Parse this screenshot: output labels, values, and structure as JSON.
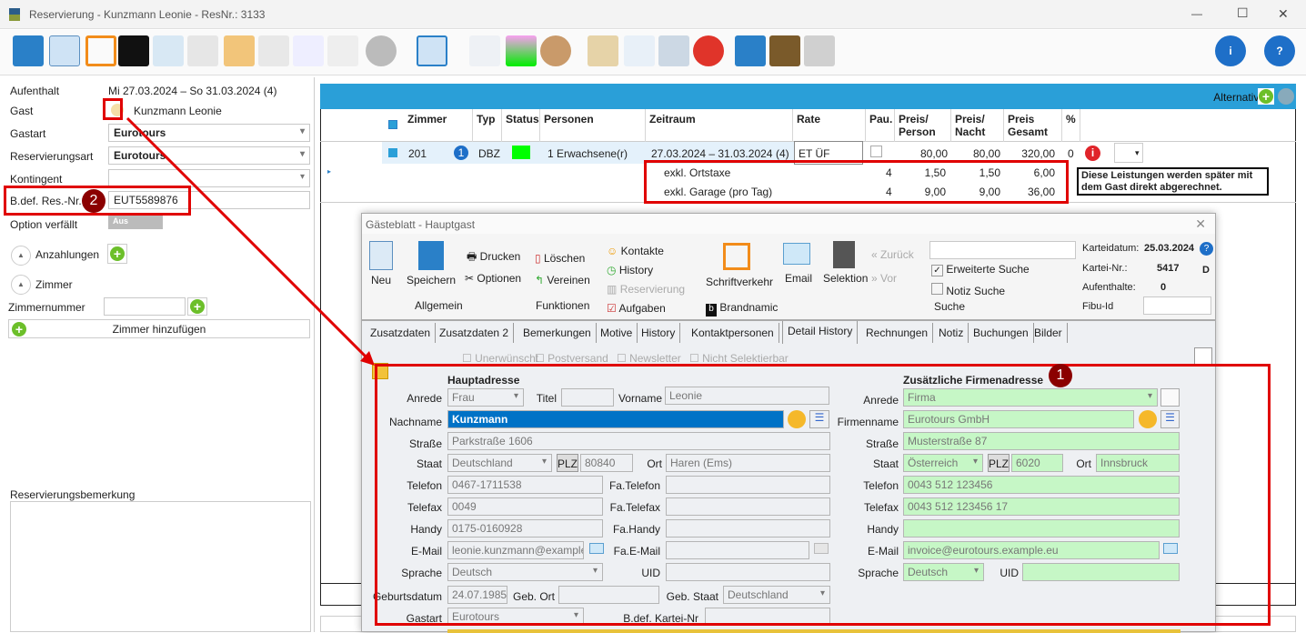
{
  "window": {
    "title": "Reservierung - Kunzmann Leonie - ResNr.: 3133",
    "minimize": "—",
    "maximize": "☐",
    "close": "✕"
  },
  "left": {
    "aufenthalt_label": "Aufenthalt",
    "aufenthalt_value": "Mi 27.03.2024 – So 31.03.2024 (4)",
    "gast_label": "Gast",
    "gast_value": "Kunzmann Leonie",
    "gastart_label": "Gastart",
    "gastart_value": "Eurotours",
    "resart_label": "Reservierungsart",
    "resart_value": "Eurotours",
    "kontingent_label": "Kontingent",
    "kontingent_value": "",
    "bdef_label": "B.def. Res.-Nr.",
    "bdef_value": "EUT5589876",
    "option_label": "Option verfällt",
    "option_toggle": "Aus",
    "anzahlungen": "Anzahlungen",
    "zimmer": "Zimmer",
    "zimmernummer": "Zimmernummer",
    "zimmer_add": "Zimmer hinzufügen",
    "bemerkung_label": "Reservierungsbemerkung"
  },
  "badges": {
    "one": "1",
    "two": "2"
  },
  "grid": {
    "alternative": "Alternative",
    "headers": [
      "Zimmer",
      "Typ",
      "Status",
      "Personen",
      "Zeitraum",
      "Rate",
      "Pau.",
      "Preis/ Person",
      "Preis/ Nacht",
      "Preis Gesamt",
      "%"
    ],
    "row": {
      "zimmer": "201",
      "num": "1",
      "typ": "DBZ",
      "status_color": "#00ff00",
      "personen": "1 Erwachsene(r)",
      "zeitraum": "27.03.2024 – 31.03.2024",
      "nights": "(4)",
      "rate": "ET ÜF",
      "preis_person": "80,00",
      "preis_nacht": "80,00",
      "preis_gesamt": "320,00",
      "prozent": "0"
    },
    "subrows": [
      {
        "name": "exkl. Ortstaxe",
        "pau": "4",
        "person": "1,50",
        "nacht": "1,50",
        "gesamt": "6,00"
      },
      {
        "name": "exkl. Garage (pro Tag)",
        "pau": "4",
        "person": "9,00",
        "nacht": "9,00",
        "gesamt": "36,00"
      }
    ],
    "note": "Diese Leistungen werden später mit dem Gast direkt abgerechnet."
  },
  "dialog": {
    "title": "Gästeblatt - Hauptgast",
    "ribbon": {
      "neu": "Neu",
      "speichern": "Speichern",
      "drucken": "Drucken",
      "optionen": "Optionen",
      "allgemein": "Allgemein",
      "loeschen": "Löschen",
      "vereinen": "Vereinen",
      "funktionen": "Funktionen",
      "kontakte": "Kontakte",
      "history": "History",
      "reservierung": "Reservierung",
      "aufgaben": "Aufgaben",
      "schriftverkehr": "Schriftverkehr",
      "email": "Email",
      "brandnamic": "Brandnamic",
      "selektion": "Selektion",
      "zurueck": "Zurück",
      "vor": "Vor",
      "suche_value": "",
      "erweiterte": "Erweiterte Suche",
      "notiz_suche": "Notiz Suche",
      "suche": "Suche",
      "karteidatum_label": "Karteidatum:",
      "karteidatum": "25.03.2024",
      "karteinr_label": "Kartei-Nr.:",
      "karteinr": "5417",
      "d": "D",
      "aufenthalte_label": "Aufenthalte:",
      "aufenthalte": "0",
      "fibu_label": "Fibu-Id",
      "fibu": ""
    },
    "tabs": [
      "Zusatzdaten",
      "Zusatzdaten 2",
      "Bemerkungen",
      "Motive",
      "History",
      "Kontaktpersonen",
      "Detail History",
      "Rechnungen",
      "Notiz",
      "Buchungen",
      "Bilder"
    ],
    "active_tab": "Detail History",
    "checks": [
      "Unerwünscht",
      "Postversand",
      "Newsletter",
      "Nicht Selektierbar"
    ],
    "haupt": {
      "heading": "Hauptadresse",
      "anrede_l": "Anrede",
      "anrede": "Frau",
      "titel_l": "Titel",
      "titel": "",
      "vorname_l": "Vorname",
      "vorname": "Leonie",
      "nachname_l": "Nachname",
      "nachname": "Kunzmann",
      "strasse_l": "Straße",
      "strasse": "Parkstraße 1606",
      "staat_l": "Staat",
      "staat": "Deutschland",
      "plz_l": "PLZ",
      "plz": "80840",
      "ort_l": "Ort",
      "ort": "Haren (Ems)",
      "telefon_l": "Telefon",
      "telefon": "0467-1711538",
      "fatelefon_l": "Fa.Telefon",
      "telefax_l": "Telefax",
      "telefax": "0049",
      "fatelefax_l": "Fa.Telefax",
      "handy_l": "Handy",
      "handy": "0175-0160928",
      "fahandy_l": "Fa.Handy",
      "email_l": "E-Mail",
      "email": "leonie.kunzmann@example",
      "faemail_l": "Fa.E-Mail",
      "sprache_l": "Sprache",
      "sprache": "Deutsch",
      "uid_l": "UID",
      "geb_l": "Geburtsdatum",
      "geb": "24.07.1985",
      "gebort_l": "Geb. Ort",
      "gebstaat_l": "Geb. Staat",
      "gebstaat": "Deutschland",
      "gastart_l": "Gastart",
      "gastart": "Eurotours",
      "bdef_l": "B.def. Kartei-Nr"
    },
    "firma": {
      "heading": "Zusätzliche Firmenadresse",
      "anrede_l": "Anrede",
      "anrede": "Firma",
      "name_l": "Firmenname",
      "name": "Eurotours GmbH",
      "strasse_l": "Straße",
      "strasse": "Musterstraße 87",
      "staat_l": "Staat",
      "staat": "Österreich",
      "plz_l": "PLZ",
      "plz": "6020",
      "ort_l": "Ort",
      "ort": "Innsbruck",
      "telefon_l": "Telefon",
      "telefon": "0043 512 123456",
      "telefax_l": "Telefax",
      "telefax": "0043 512 123456 17",
      "handy_l": "Handy",
      "handy": "",
      "email_l": "E-Mail",
      "email": "invoice@eurotours.example.eu",
      "sprache_l": "Sprache",
      "sprache": "Deutsch",
      "uid_l": "UID"
    }
  },
  "colors": {
    "accent": "#2a9fd8",
    "highlight": "#e00000",
    "badge": "#8b0000",
    "green_field": "#c6f7c6",
    "selected": "#0072c6"
  }
}
